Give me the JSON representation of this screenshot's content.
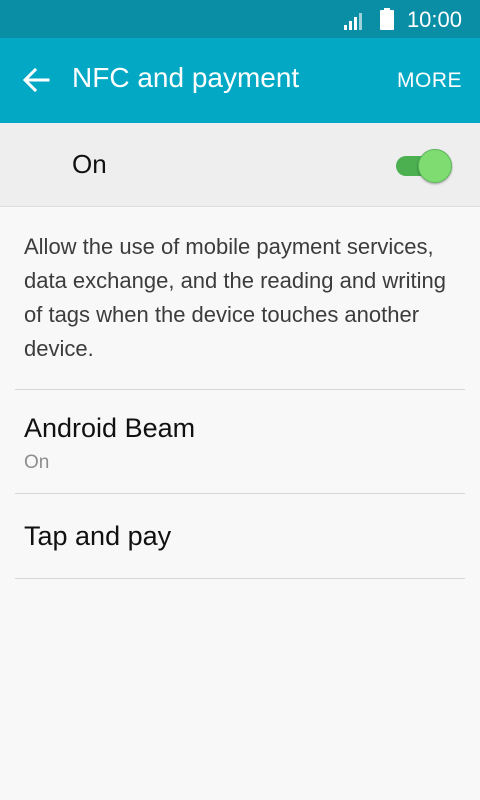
{
  "status_bar": {
    "time": "10:00",
    "icons": [
      "signal-icon",
      "battery-icon"
    ]
  },
  "app_bar": {
    "back_icon": "arrow-back-icon",
    "title": "NFC and payment",
    "more_label": "MORE",
    "color": "#03a9c4"
  },
  "master_switch": {
    "label": "On",
    "state": "on",
    "accent": "#4caf50"
  },
  "description": "Allow the use of mobile payment services, data exchange, and the reading and writing of tags when the device touches another device.",
  "items": [
    {
      "title": "Android Beam",
      "subtitle": "On"
    },
    {
      "title": "Tap and pay"
    }
  ]
}
